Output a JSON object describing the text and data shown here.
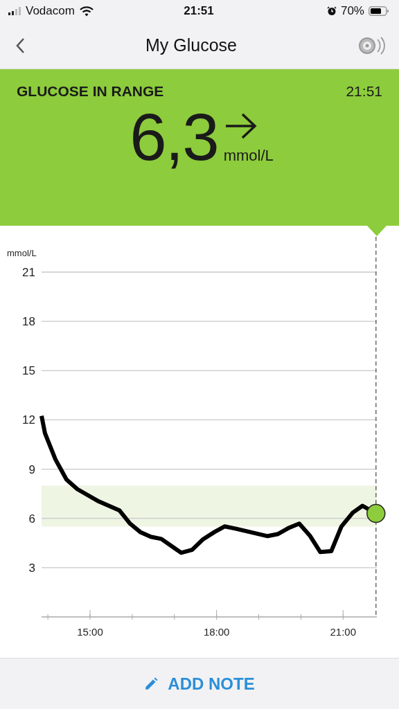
{
  "status_bar": {
    "carrier": "Vodacom",
    "time": "21:51",
    "battery": "70%"
  },
  "nav": {
    "title": "My Glucose"
  },
  "reading": {
    "status": "GLUCOSE IN RANGE",
    "time": "21:51",
    "value": "6,3",
    "unit": "mmol/L"
  },
  "chart": {
    "chart_data": {
      "type": "line",
      "ylabel": "mmol/L",
      "x": [
        13.85,
        13.93,
        14.18,
        14.44,
        14.7,
        15.21,
        15.7,
        15.95,
        16.19,
        16.44,
        16.69,
        17.16,
        17.42,
        17.67,
        17.95,
        18.19,
        18.44,
        18.93,
        19.21,
        19.46,
        19.72,
        19.96,
        20.21,
        20.46,
        20.72,
        20.96,
        21.23,
        21.46,
        21.78
      ],
      "series": [
        {
          "color": "#000000",
          "values": [
            12.24,
            11.19,
            9.59,
            8.37,
            7.78,
            7.03,
            6.48,
            5.68,
            5.17,
            4.88,
            4.75,
            3.91,
            4.08,
            4.71,
            5.17,
            5.51,
            5.38,
            5.09,
            4.92,
            5.05,
            5.43,
            5.68,
            4.96,
            3.95,
            4.0,
            5.51,
            6.35,
            6.77,
            6.3
          ]
        }
      ],
      "xlim": [
        13.85,
        21.8
      ],
      "ylim": [
        0,
        21
      ],
      "xticks": [
        {
          "value": 15,
          "label": "15:00"
        },
        {
          "value": 18,
          "label": "18:00"
        },
        {
          "value": 21,
          "label": "21:00"
        }
      ],
      "yticks": [
        3,
        6,
        9,
        12,
        15,
        18,
        21
      ],
      "grid": true,
      "bands": [
        {
          "axis": "y",
          "from": 5.5,
          "to": 8
        }
      ]
    }
  },
  "footer": {
    "button": "ADD NOTE"
  }
}
